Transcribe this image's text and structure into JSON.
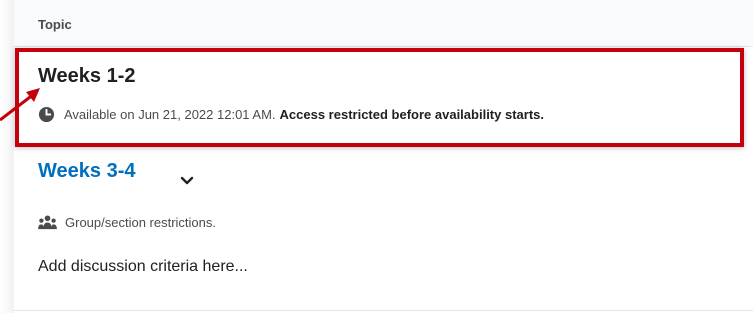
{
  "header": {
    "label": "Topic"
  },
  "topics": [
    {
      "title": "Weeks 1-2",
      "availability": "Available on Jun 21, 2022 12:01 AM.",
      "restriction_note": "Access restricted before availability starts."
    },
    {
      "title": "Weeks 3-4",
      "restriction": "Group/section restrictions.",
      "description": "Add discussion criteria here..."
    }
  ],
  "icons": {
    "clock": "clock-icon",
    "chevron": "chevron-down-icon",
    "group": "group-icon",
    "arrow": "annotation-arrow"
  },
  "colors": {
    "highlight_border": "#c4000c",
    "link": "#006fbf",
    "header_bg": "#f9fafb",
    "text": "#202122",
    "secondary_text": "#494c4e"
  }
}
